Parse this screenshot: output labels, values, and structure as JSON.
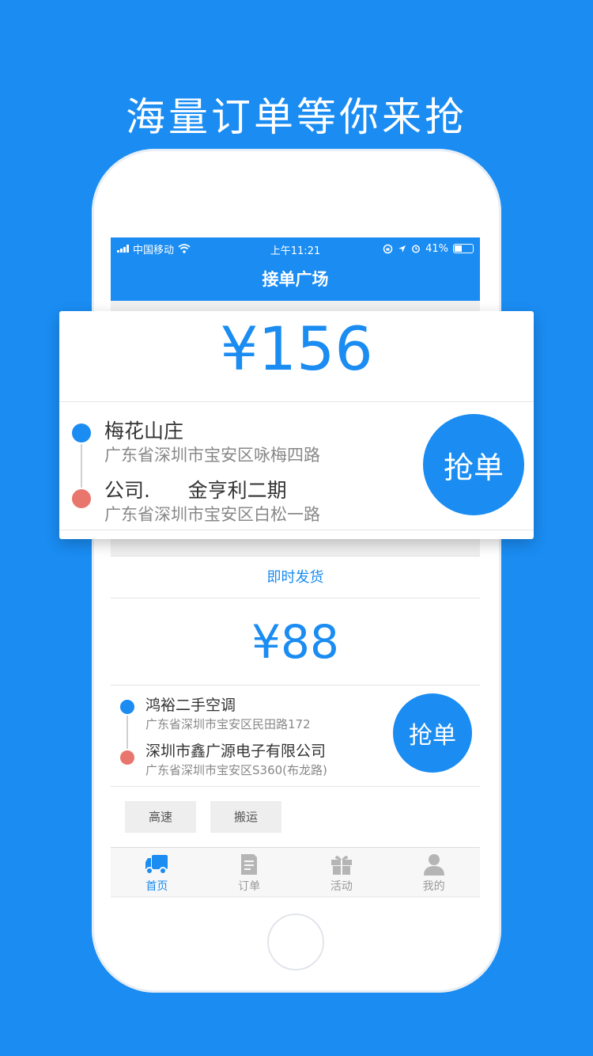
{
  "headline": "海量订单等你来抢",
  "status_bar": {
    "carrier": "中国移动",
    "time": "上午11:21",
    "battery": "41%"
  },
  "nav_title": "接单广场",
  "featured_order": {
    "price": "¥156",
    "pickup": {
      "name": "梅花山庄",
      "address": "广东省深圳市宝安区咏梅四路"
    },
    "dropoff": {
      "name": "公司.      金亨利二期",
      "address": "广东省深圳市宝安区白松一路"
    },
    "grab_label": "抢单"
  },
  "order": {
    "type": "即时发货",
    "price": "¥88",
    "pickup": {
      "name": "鸿裕二手空调",
      "address": "广东省深圳市宝安区民田路172"
    },
    "dropoff": {
      "name": "深圳市鑫广源电子有限公司",
      "address": "广东省深圳市宝安区S360(布龙路)"
    },
    "grab_label": "抢单",
    "tags": [
      "高速",
      "搬运"
    ]
  },
  "tabs": [
    {
      "label": "首页",
      "icon": "truck-icon",
      "active": true
    },
    {
      "label": "订单",
      "icon": "document-icon",
      "active": false
    },
    {
      "label": "活动",
      "icon": "gift-icon",
      "active": false
    },
    {
      "label": "我的",
      "icon": "person-icon",
      "active": false
    }
  ],
  "colors": {
    "primary": "#1a8cf2",
    "dropoff_dot": "#e8766d"
  }
}
